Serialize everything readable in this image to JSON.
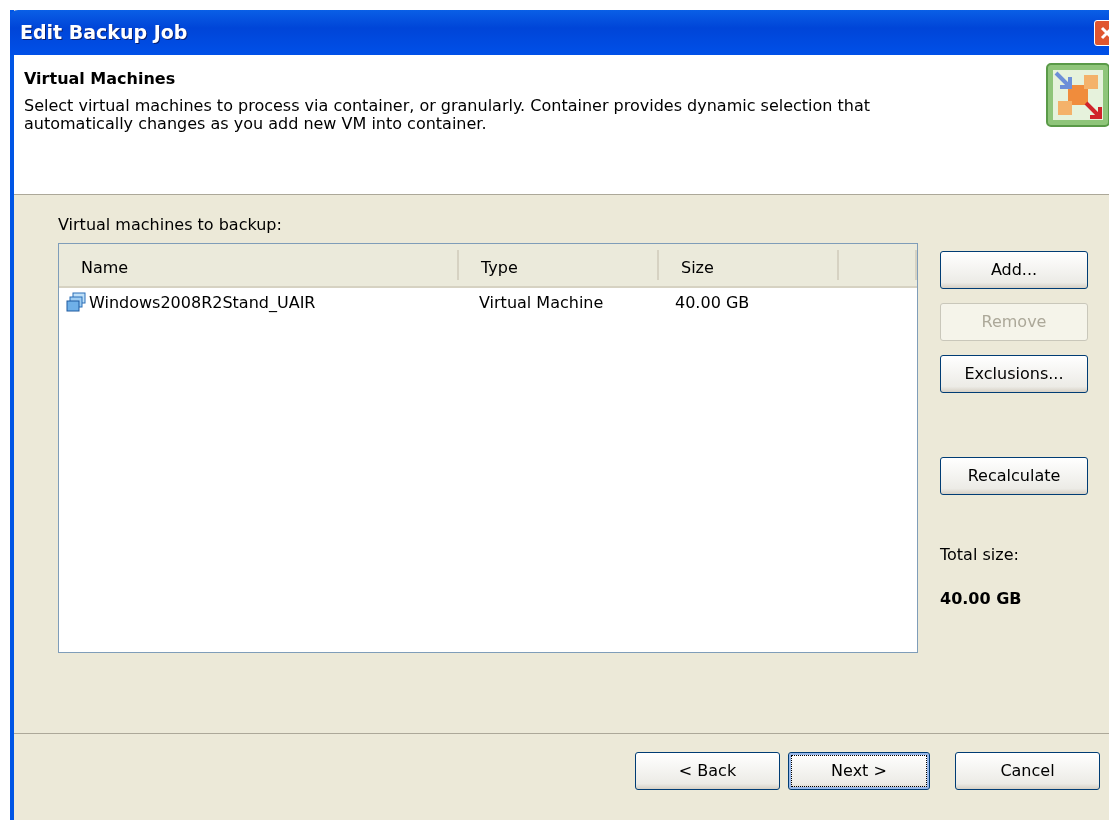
{
  "window": {
    "title": "Edit Backup Job"
  },
  "header": {
    "title": "Virtual Machines",
    "description": "Select virtual machines to process via container, or granularly. Container provides dynamic selection that automatically changes as you add new VM into container."
  },
  "list": {
    "label": "Virtual machines to backup:",
    "columns": [
      "Name",
      "Type",
      "Size"
    ],
    "rows": [
      {
        "name": "Windows2008R2Stand_UAIR",
        "type": "Virtual Machine",
        "size": "40.00 GB",
        "selected": false
      }
    ]
  },
  "side_buttons": [
    {
      "label": "Add...",
      "disabled": false
    },
    {
      "label": "Remove",
      "disabled": true
    },
    {
      "label": "Exclusions...",
      "disabled": false
    },
    {
      "label": "Recalculate",
      "disabled": false
    }
  ],
  "total": {
    "label": "Total size:",
    "value": "40.00 GB"
  },
  "footer_buttons": [
    {
      "label": "< Back",
      "focused": false
    },
    {
      "label": "Next >",
      "focused": true
    },
    {
      "label": "Cancel",
      "focused": false
    }
  ]
}
